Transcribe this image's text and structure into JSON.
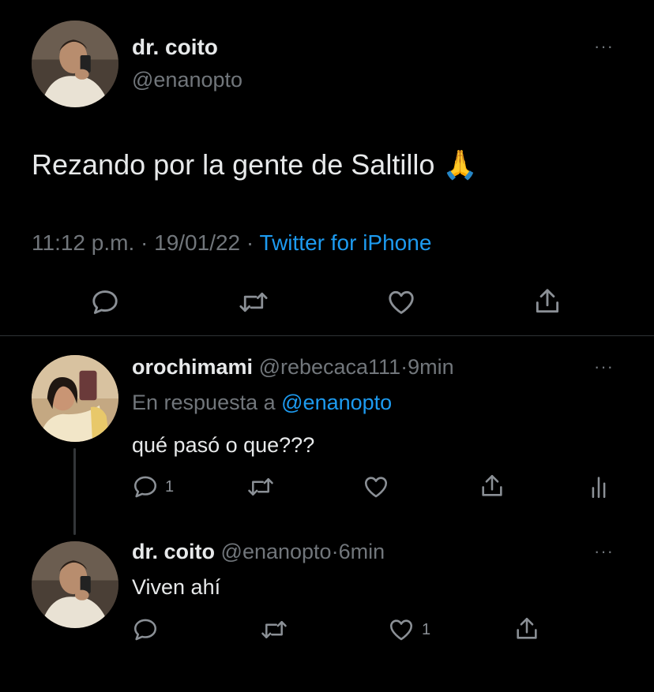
{
  "main_tweet": {
    "author_name": "dr. coito",
    "handle": "@enanopto",
    "more": "···",
    "text": "Rezando por la gente de Saltillo 🙏",
    "time": "11:12 p.m.",
    "sep": "·",
    "date": "19/01/22",
    "source": "Twitter for iPhone",
    "actions": [
      "reply-icon",
      "retweet-icon",
      "like-icon",
      "share-icon"
    ]
  },
  "replies": [
    {
      "author_name": "orochimami",
      "handle": "@rebecaca111",
      "sep": "·",
      "age": "9min",
      "more": "···",
      "reply_prefix": "En respuesta a",
      "reply_to": "@enanopto",
      "text": "qué pasó o que???",
      "reply_count": "1",
      "actions": [
        "reply-icon",
        "retweet-icon",
        "like-icon",
        "share-icon",
        "analytics-icon"
      ]
    },
    {
      "author_name": "dr. coito",
      "handle": "@enanopto",
      "sep": "·",
      "age": "6min",
      "more": "···",
      "text": "Viven ahí",
      "like_count": "1",
      "actions": [
        "reply-icon",
        "retweet-icon",
        "like-icon",
        "share-icon"
      ]
    }
  ],
  "colors": {
    "background": "#000000",
    "text": "#e7e9ea",
    "muted": "#71767b",
    "link": "#1d9bf0",
    "divider": "#2f3336"
  }
}
